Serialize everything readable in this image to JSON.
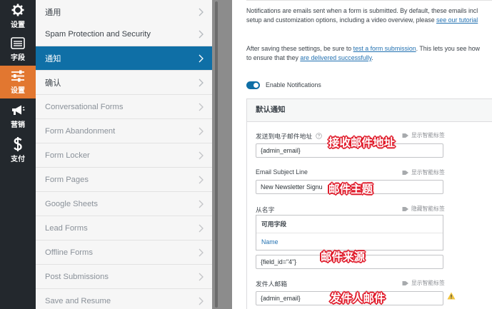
{
  "rail": {
    "items": [
      {
        "label": "设置",
        "icon": "gear-icon"
      },
      {
        "label": "字段",
        "icon": "list-icon"
      },
      {
        "label": "设置",
        "icon": "sliders-icon"
      },
      {
        "label": "营销",
        "icon": "megaphone-icon"
      },
      {
        "label": "支付",
        "icon": "dollar-icon"
      }
    ],
    "active_color": "#e27730"
  },
  "subnav": {
    "items": [
      {
        "label": "通用"
      },
      {
        "label": "Spam Protection and Security"
      },
      {
        "label": "通知"
      },
      {
        "label": "确认"
      },
      {
        "label": "Conversational Forms"
      },
      {
        "label": "Form Abandonment"
      },
      {
        "label": "Form Locker"
      },
      {
        "label": "Form Pages"
      },
      {
        "label": "Google Sheets"
      },
      {
        "label": "Lead Forms"
      },
      {
        "label": "Offline Forms"
      },
      {
        "label": "Post Submissions"
      },
      {
        "label": "Save and Resume"
      }
    ],
    "active_color": "#0f6fa6"
  },
  "intro": {
    "p1_line1": "Notifications are emails sent when a form is submitted. By default, these emails incl",
    "p1_line2_pre": "setup and customization options, including a video overview, please ",
    "p1_line2_link": "see our tutorial",
    "p2_line1_pre": "After saving these settings, be sure to ",
    "p2_line1_link": "test a form submission",
    "p2_line1_post": ". This lets you see how",
    "p2_line2_pre": "to ensure that they ",
    "p2_line2_link": "are delivered successfully",
    "p2_line2_post": "."
  },
  "toggle": {
    "label": "Enable Notifications",
    "on": true
  },
  "panel": {
    "title": "默认通知",
    "fields": {
      "send_to": {
        "label": "发送到电子邮件地址",
        "smart": "显示智能标签",
        "value": "{admin_email}"
      },
      "subject": {
        "label": "Email Subject Line",
        "smart": "显示智能标签",
        "value": "New Newsletter Signu"
      },
      "from_name": {
        "label": "从名字",
        "smart": "隐藏智能标签",
        "value": "{field_id=\"4\"}"
      },
      "from_email": {
        "label": "发件人邮箱",
        "smart": "显示智能标签",
        "value": "{admin_email}"
      }
    },
    "available": {
      "title": "可用字段",
      "item": "Name"
    }
  },
  "annotations": {
    "recipient": "接收邮件地址",
    "subject": "邮件主题",
    "source": "邮件来源",
    "sender": "发件人邮件"
  }
}
